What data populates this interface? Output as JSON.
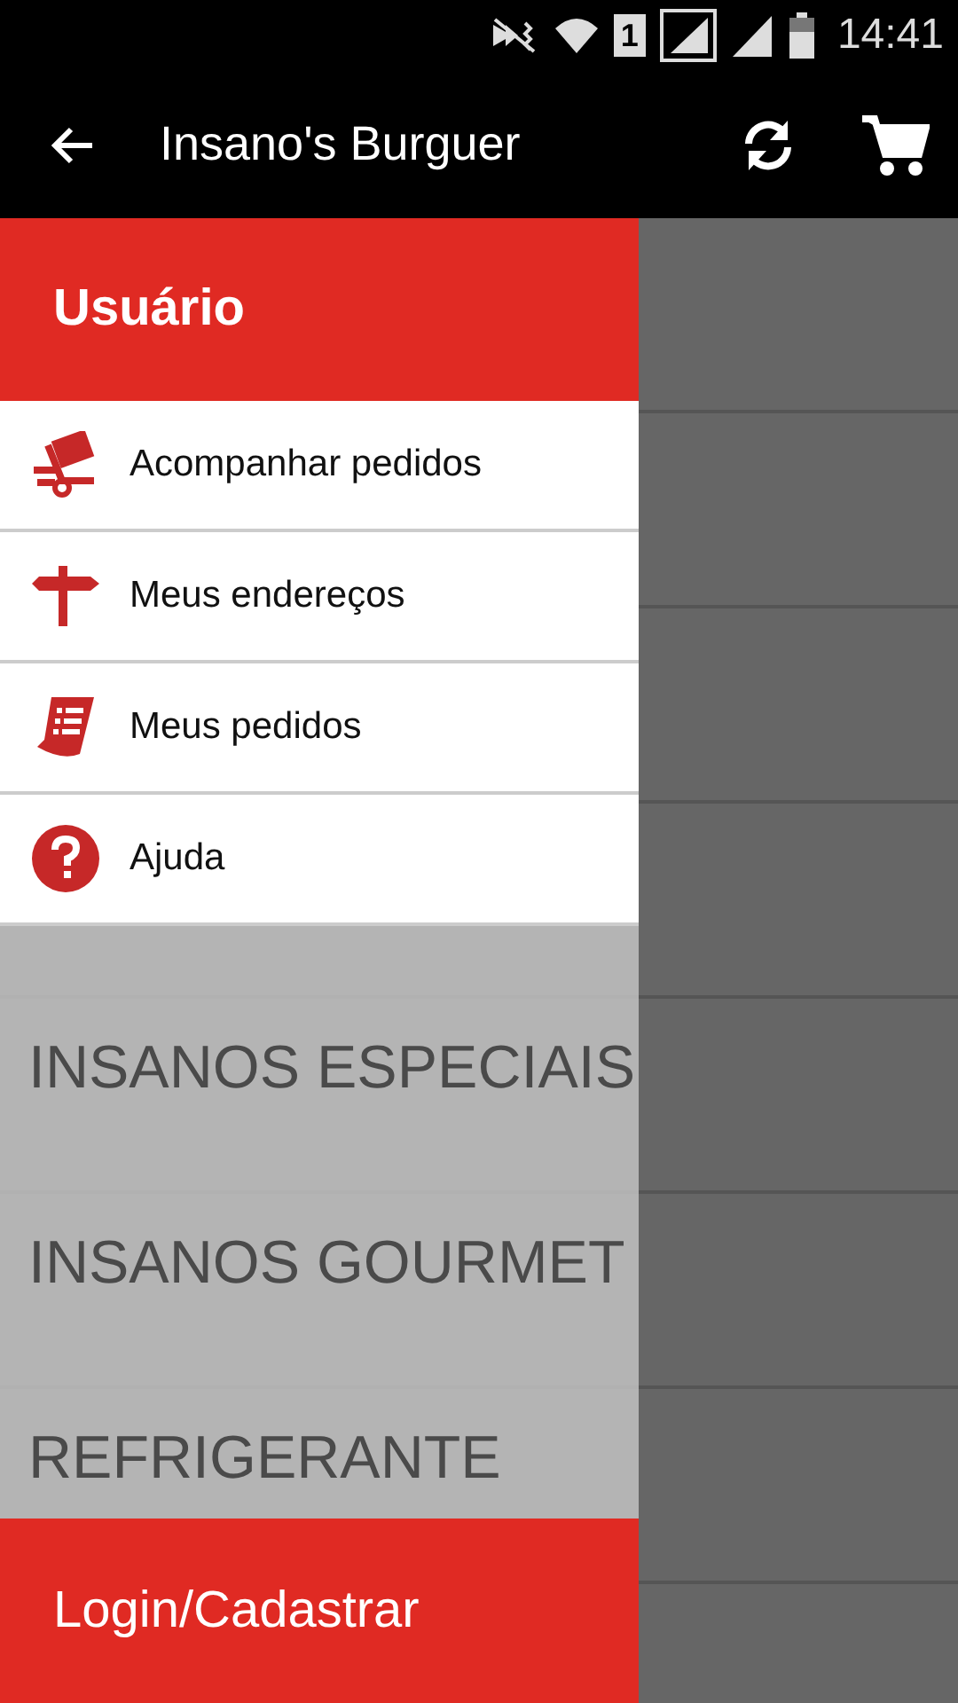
{
  "status_bar": {
    "sim": "1",
    "time": "14:41"
  },
  "app_bar": {
    "title": "Insano's Burguer"
  },
  "categories": [
    {
      "label": "INSANOS ESPECIAIS"
    },
    {
      "label": "INSANOS GOURMET"
    },
    {
      "label": "REFRIGERANTE"
    }
  ],
  "drawer": {
    "header": "Usuário",
    "items": [
      {
        "kind": "truck",
        "label": "Acompanhar pedidos"
      },
      {
        "kind": "signpost",
        "label": "Meus endereços"
      },
      {
        "kind": "receipt",
        "label": "Meus pedidos"
      },
      {
        "kind": "help",
        "label": "Ajuda"
      }
    ],
    "footer_button": "Login/Cadastrar"
  }
}
